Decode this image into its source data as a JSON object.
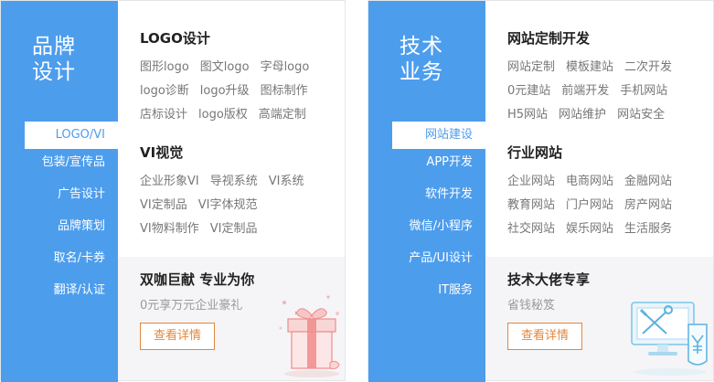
{
  "brand": {
    "side_title_line1": "品牌",
    "side_title_line2": "设计",
    "menu": [
      "LOGO/VI",
      "包装/宣传品",
      "广告设计",
      "品牌策划",
      "取名/卡券",
      "翻译/认证"
    ],
    "sections": [
      {
        "title": "LOGO设计",
        "links": [
          [
            "图形logo",
            "图文logo",
            "字母logo"
          ],
          [
            "logo诊断",
            "logo升级",
            "图标制作"
          ],
          [
            "店标设计",
            "logo版权",
            "高端定制"
          ]
        ]
      },
      {
        "title": "VI视觉",
        "links": [
          [
            "企业形象VI",
            "导视系统",
            "VI系统"
          ],
          [
            "VI定制品",
            "VI字体规范"
          ],
          [
            "VI物料制作",
            "VI定制品"
          ]
        ]
      }
    ],
    "promo": {
      "title": "双咖巨献 专业为你",
      "subtitle": "0元享万元企业豪礼",
      "cta": "查看详情"
    }
  },
  "tech": {
    "side_title_line1": "技术",
    "side_title_line2": "业务",
    "menu": [
      "网站建设",
      "APP开发",
      "软件开发",
      "微信/小程序",
      "产品/UI设计",
      "IT服务"
    ],
    "sections": [
      {
        "title": "网站定制开发",
        "links": [
          [
            "网站定制",
            "模板建站",
            "二次开发"
          ],
          [
            "0元建站",
            "前端开发",
            "手机网站"
          ],
          [
            "H5网站",
            "网站维护",
            "网站安全"
          ]
        ]
      },
      {
        "title": "行业网站",
        "links": [
          [
            "企业网站",
            "电商网站",
            "金融网站"
          ],
          [
            "教育网站",
            "门户网站",
            "房产网站"
          ],
          [
            "社交网站",
            "娱乐网站",
            "生活服务"
          ]
        ]
      }
    ],
    "promo": {
      "title": "技术大佬专享",
      "subtitle": "省钱秘笈",
      "cta": "查看详情"
    }
  },
  "colors": {
    "accent": "#4d9ded",
    "cta": "#e3873c",
    "gift": "#f08b8b"
  }
}
